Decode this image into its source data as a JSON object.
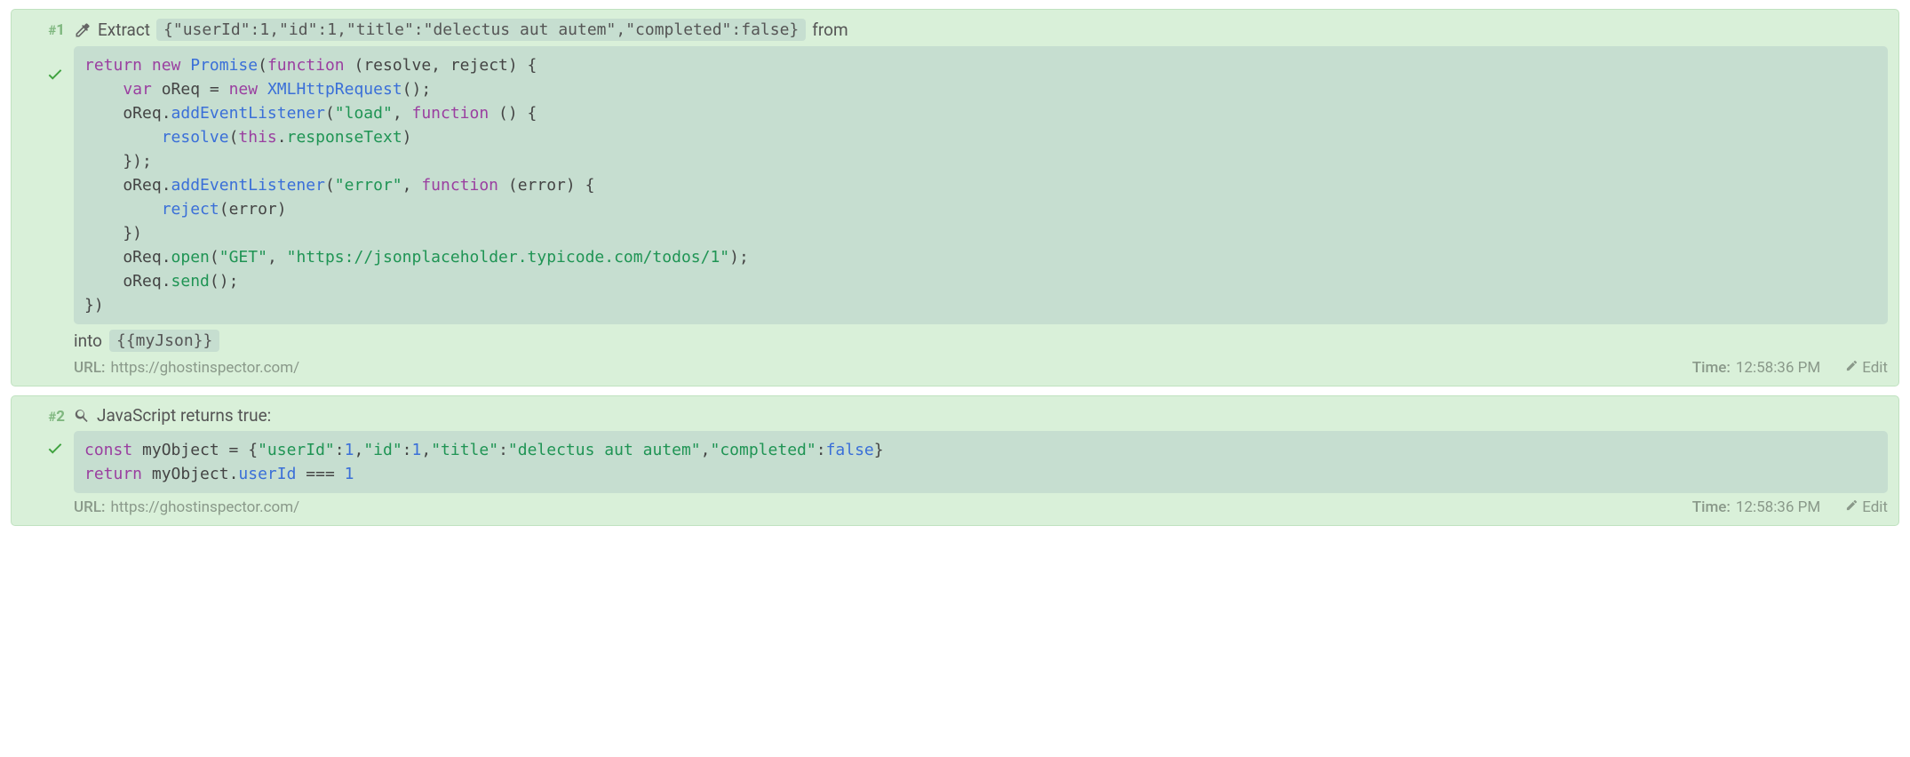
{
  "steps": [
    {
      "number": "1",
      "iconName": "eyedropper-icon",
      "titlePrefix": "Extract",
      "titleInlineCode": "{\"userId\":1,\"id\":1,\"title\":\"delectus aut autem\",\"completed\":false}",
      "titleSuffix": "from",
      "intoLabel": "into",
      "intoVar": "{{myJson}}",
      "urlLabel": "URL:",
      "url": "https://ghostinspector.com/",
      "timeLabel": "Time:",
      "time": "12:58:36 PM",
      "editLabel": "Edit",
      "code": "return new Promise(function (resolve, reject) {\n    var oReq = new XMLHttpRequest();\n    oReq.addEventListener(\"load\", function () {\n        resolve(this.responseText)\n    });\n    oReq.addEventListener(\"error\", function (error) {\n        reject(error)\n    })\n    oReq.open(\"GET\", \"https://jsonplaceholder.typicode.com/todos/1\");\n    oReq.send();\n})"
    },
    {
      "number": "2",
      "iconName": "magnifier-icon",
      "titlePrefix": "JavaScript returns true:",
      "urlLabel": "URL:",
      "url": "https://ghostinspector.com/",
      "timeLabel": "Time:",
      "time": "12:58:36 PM",
      "editLabel": "Edit",
      "code": "const myObject = {\"userId\":1,\"id\":1,\"title\":\"delectus aut autem\",\"completed\":false}\nreturn myObject.userId === 1"
    }
  ]
}
